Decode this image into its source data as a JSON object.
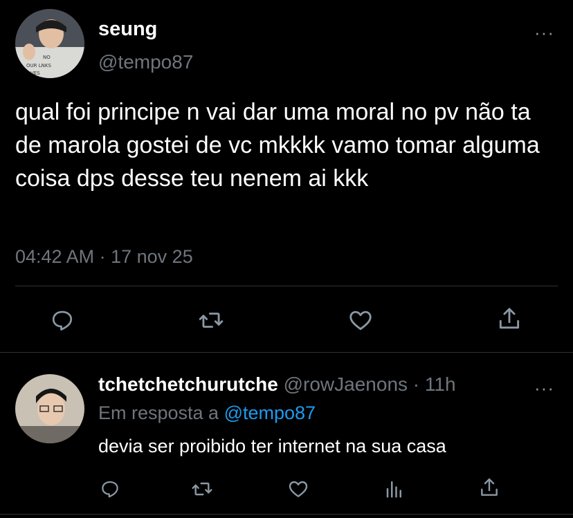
{
  "main_tweet": {
    "author_name": "seung",
    "author_handle": "@tempo87",
    "text": "qual foi principe n vai dar uma moral no pv não ta de marola gostei de vc mkkkk vamo tomar alguma coisa dps desse teu nenem ai kkk",
    "time": "04:42 AM",
    "separator": "·",
    "date": "17 nov 25",
    "more": "···",
    "actions": [
      "reply-icon",
      "retweet-icon",
      "like-icon",
      "share-icon"
    ]
  },
  "reply": {
    "author_name": "tchetchetchurutche",
    "author_handle": "@rowJaenons",
    "separator": "·",
    "time_ago": "11h",
    "more": "···",
    "replying_prefix": "Em resposta a",
    "replying_to": "@tempo87",
    "text": "devia ser proibido ter internet na sua casa",
    "actions": [
      "reply-icon",
      "retweet-icon",
      "like-icon",
      "analytics-icon",
      "share-icon"
    ]
  },
  "colors": {
    "background": "#000000",
    "text": "#ffffff",
    "muted": "#6e767d",
    "link": "#1d9bf0",
    "divider": "#2f3336"
  }
}
